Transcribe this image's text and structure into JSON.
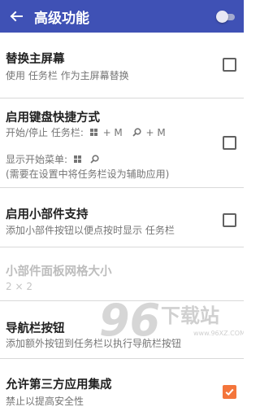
{
  "toolbar": {
    "title": "高级功能",
    "master_toggle_on": false,
    "colors": {
      "bar": "#3f51b5",
      "accent": "#f4753b"
    }
  },
  "settings": [
    {
      "title": "替换主屏幕",
      "subtitle": "使用 任务栏 作为主屏幕替换",
      "checked": false
    },
    {
      "title": "启用键盘快捷方式",
      "shortcut_prefix": "开始/停止 任务栏:",
      "shortcut_1": "+ M",
      "shortcut_2": "+ M",
      "menu_label": "显示开始菜单:",
      "note": "(需要在设置中将任务栏设为辅助应用)",
      "checked": false
    },
    {
      "title": "启用小部件支持",
      "subtitle": "添加小部件按钮以便点按时显示 任务栏",
      "checked": false
    },
    {
      "title": "小部件面板网格大小",
      "subtitle": "2 × 2",
      "disabled": true
    },
    {
      "title": "导航栏按钮",
      "subtitle": "添加额外按钮到任务栏以执行导航栏按钮"
    },
    {
      "title": "允许第三方应用集成",
      "subtitle": "禁止以提高安全性",
      "checked": true
    }
  ],
  "watermark": {
    "logo": "96",
    "brand": "下载站",
    "url": "www.96XZ.COM"
  }
}
